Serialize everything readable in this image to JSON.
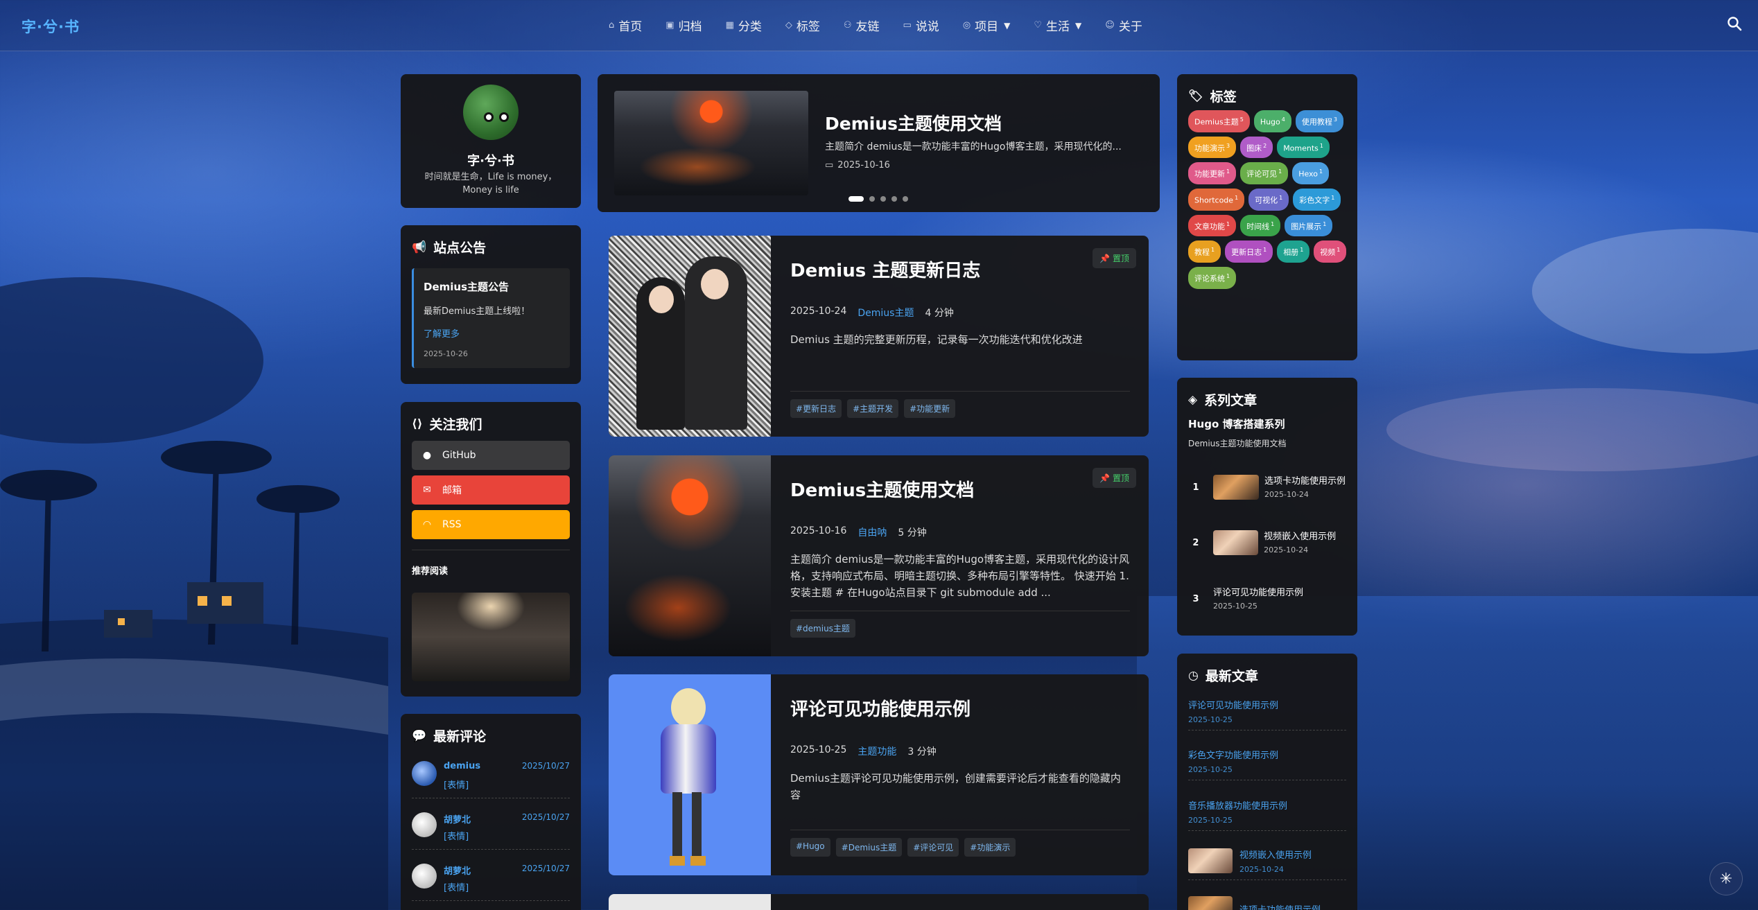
{
  "site": {
    "brand": "字·兮·书"
  },
  "nav": {
    "items": [
      {
        "label": "首页",
        "icon": "home-icon",
        "glyph": "⌂"
      },
      {
        "label": "归档",
        "icon": "archive-icon",
        "glyph": "▣"
      },
      {
        "label": "分类",
        "icon": "grid-icon",
        "glyph": "▦"
      },
      {
        "label": "标签",
        "icon": "tag-icon",
        "glyph": "◇"
      },
      {
        "label": "友链",
        "icon": "friends-icon",
        "glyph": "⚇"
      },
      {
        "label": "说说",
        "icon": "chat-icon",
        "glyph": "▭"
      },
      {
        "label": "项目",
        "icon": "project-icon",
        "glyph": "◎",
        "dropdown": true
      },
      {
        "label": "生活",
        "icon": "heart-icon",
        "glyph": "♡",
        "dropdown": true
      },
      {
        "label": "关于",
        "icon": "user-icon",
        "glyph": "☺"
      }
    ]
  },
  "profile": {
    "name": "字·兮·书",
    "bio": "时间就是生命，Life is money，Money is life"
  },
  "notice": {
    "title": "站点公告",
    "item_title": "Demius主题公告",
    "item_body": "最新Demius主题上线啦！",
    "link": "了解更多",
    "date": "2025-10-26"
  },
  "follow": {
    "title": "关注我们",
    "buttons": [
      {
        "label": "GitHub",
        "icon": "github-icon",
        "color": "#3a3a3c"
      },
      {
        "label": "邮箱",
        "icon": "mail-icon",
        "color": "#e8443a"
      },
      {
        "label": "RSS",
        "icon": "rss-icon",
        "color": "#ffa800"
      }
    ],
    "recommend_title": "推荐阅读"
  },
  "comments": {
    "title": "最新评论",
    "items": [
      {
        "name": "demius",
        "date": "2025/10/27",
        "text": "[表情]"
      },
      {
        "name": "胡萝北",
        "date": "2025/10/27",
        "text": "[表情]"
      },
      {
        "name": "胡萝北",
        "date": "2025/10/27",
        "text": "[表情]"
      }
    ]
  },
  "featured": {
    "title": "Demius主题使用文档",
    "desc": "主题简介 demius是一款功能丰富的Hugo博客主题，采用现代化的...",
    "date": "2025-10-16",
    "slides": 5,
    "active_slide": 1
  },
  "posts": [
    {
      "title": "Demius 主题更新日志",
      "date": "2025-10-24",
      "category": "Demius主题",
      "read": "4 分钟",
      "desc": "Demius 主题的完整更新历程，记录每一次功能迭代和优化改进",
      "tags": [
        "#更新日志",
        "#主题开发",
        "#功能更新"
      ],
      "pinned": true
    },
    {
      "title": "Demius主题使用文档",
      "date": "2025-10-16",
      "category": "自由呐",
      "read": "5 分钟",
      "desc": "主题简介 demius是一款功能丰富的Hugo博客主题，采用现代化的设计风格，支持响应式布局、明暗主题切换、多种布局引擎等特性。 快速开始 1. 安装主题 # 在Hugo站点目录下 git submodule add ...",
      "tags": [
        "#demius主题"
      ],
      "pinned": true
    },
    {
      "title": "评论可见功能使用示例",
      "date": "2025-10-25",
      "category": "主题功能",
      "read": "3 分钟",
      "desc": "Demius主题评论可见功能使用示例，创建需要评论后才能查看的隐藏内容",
      "tags": [
        "#Hugo",
        "#Demius主题",
        "#评论可见",
        "#功能演示"
      ],
      "pinned": false
    }
  ],
  "pin_label": "置顶",
  "tags": {
    "title": "标签",
    "items": [
      {
        "label": "Demius主题",
        "count": "5",
        "color": "#e0565b"
      },
      {
        "label": "Hugo",
        "count": "4",
        "color": "#4caf6a"
      },
      {
        "label": "使用教程",
        "count": "3",
        "color": "#3d8fd6"
      },
      {
        "label": "功能演示",
        "count": "3",
        "color": "#f0a020"
      },
      {
        "label": "图床",
        "count": "2",
        "color": "#b05cc8"
      },
      {
        "label": "Moments",
        "count": "1",
        "color": "#1ea38a"
      },
      {
        "label": "功能更新",
        "count": "1",
        "color": "#e05a8a"
      },
      {
        "label": "评论可见",
        "count": "1",
        "color": "#6aae4a"
      },
      {
        "label": "Hexo",
        "count": "1",
        "color": "#4a9ee0"
      },
      {
        "label": "Shortcode",
        "count": "1",
        "color": "#e0683a"
      },
      {
        "label": "可视化",
        "count": "1",
        "color": "#6a6ac8"
      },
      {
        "label": "彩色文字",
        "count": "1",
        "color": "#2c9ad8"
      },
      {
        "label": "文章功能",
        "count": "1",
        "color": "#e04848"
      },
      {
        "label": "时间线",
        "count": "1",
        "color": "#3aa34a"
      },
      {
        "label": "图片展示",
        "count": "1",
        "color": "#3a8ed8"
      },
      {
        "label": "教程",
        "count": "1",
        "color": "#e8a020"
      },
      {
        "label": "更新日志",
        "count": "1",
        "color": "#b050c0"
      },
      {
        "label": "相册",
        "count": "1",
        "color": "#1ea390"
      },
      {
        "label": "视频",
        "count": "1",
        "color": "#e0507a"
      },
      {
        "label": "评论系统",
        "count": "1",
        "color": "#7ab04a"
      }
    ]
  },
  "series": {
    "title": "系列文章",
    "name": "Hugo 博客搭建系列",
    "subtitle": "Demius主题功能使用文档",
    "items": [
      {
        "num": "1",
        "title": "选项卡功能使用示例",
        "date": "2025-10-24",
        "thumb": true
      },
      {
        "num": "2",
        "title": "视频嵌入使用示例",
        "date": "2025-10-24",
        "thumb": true
      },
      {
        "num": "3",
        "title": "评论可见功能使用示例",
        "date": "2025-10-25",
        "thumb": false
      }
    ]
  },
  "recent": {
    "title": "最新文章",
    "items": [
      {
        "title": "评论可见功能使用示例",
        "date": "2025-10-25"
      },
      {
        "title": "彩色文字功能使用示例",
        "date": "2025-10-25"
      },
      {
        "title": "音乐播放器功能使用示例",
        "date": "2025-10-25"
      },
      {
        "title": "视频嵌入使用示例",
        "date": "2025-10-24"
      },
      {
        "title": "选项卡功能使用示例",
        "date": ""
      }
    ]
  }
}
